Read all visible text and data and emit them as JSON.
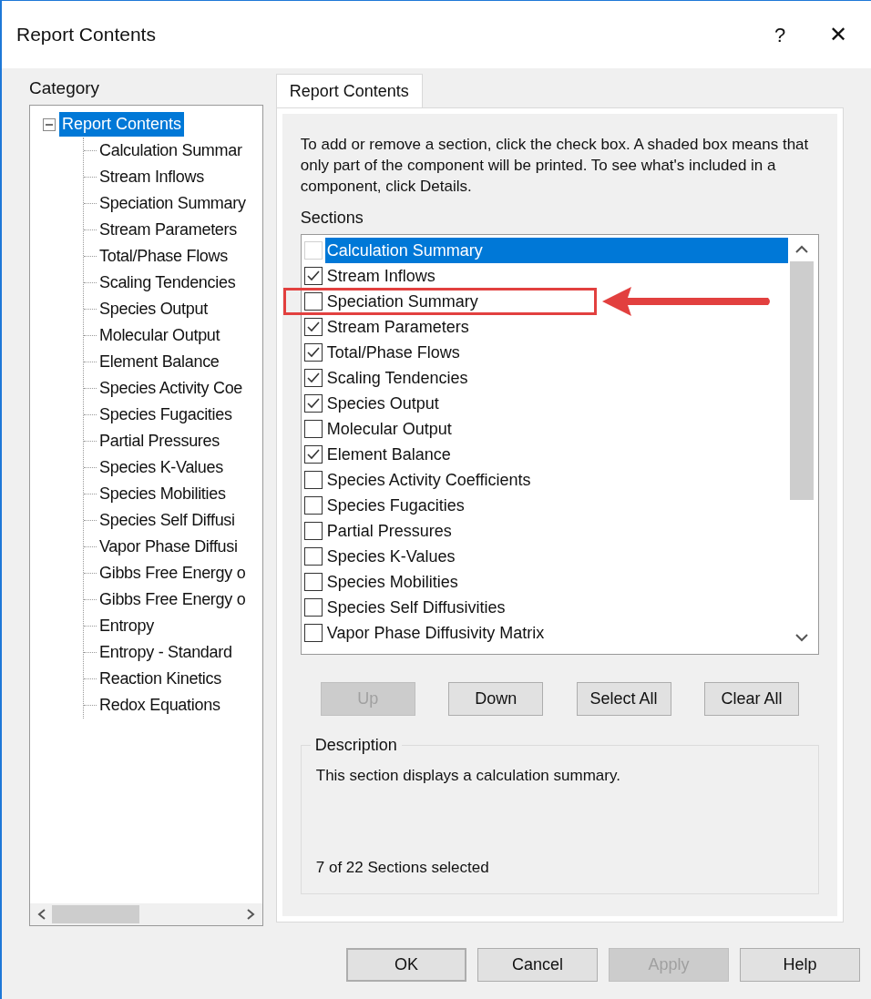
{
  "window": {
    "title": "Report Contents",
    "help_glyph": "?",
    "close_glyph": "✕"
  },
  "category": {
    "label": "Category",
    "tree": [
      {
        "label": "Report Contents",
        "selected": true,
        "expanded": true,
        "children": [
          {
            "label": "Calculation Summar",
            "selected": false
          },
          {
            "label": "Stream Inflows",
            "selected": false
          },
          {
            "label": "Speciation Summary",
            "selected": false
          },
          {
            "label": "Stream Parameters",
            "selected": false
          },
          {
            "label": "Total/Phase Flows",
            "selected": false
          },
          {
            "label": "Scaling Tendencies",
            "selected": false
          },
          {
            "label": "Species Output",
            "selected": false
          },
          {
            "label": "Molecular Output",
            "selected": false
          },
          {
            "label": "Element Balance",
            "selected": false
          },
          {
            "label": "Species Activity Coe",
            "selected": false
          },
          {
            "label": "Species Fugacities",
            "selected": false
          },
          {
            "label": "Partial Pressures",
            "selected": false
          },
          {
            "label": "Species K-Values",
            "selected": false
          },
          {
            "label": "Species Mobilities",
            "selected": false
          },
          {
            "label": "Species Self Diffusi",
            "selected": false
          },
          {
            "label": "Vapor Phase Diffusi",
            "selected": false
          },
          {
            "label": "Gibbs Free Energy o",
            "selected": false
          },
          {
            "label": "Gibbs Free Energy o",
            "selected": false
          },
          {
            "label": "Entropy",
            "selected": false
          },
          {
            "label": "Entropy - Standard",
            "selected": false
          },
          {
            "label": "Reaction Kinetics",
            "selected": false
          },
          {
            "label": "Redox Equations",
            "selected": false
          }
        ]
      }
    ]
  },
  "tabs": [
    {
      "label": "Report Contents",
      "selected": true
    }
  ],
  "instructions": "To add or remove a section, click the check box. A shaded box means that only part of the component will be printed. To see what's included in a component, click Details.",
  "sections": {
    "label": "Sections",
    "items": [
      {
        "label": "Calculation Summary",
        "checked": false,
        "selected": true,
        "highlighted": false
      },
      {
        "label": "Stream Inflows",
        "checked": true,
        "selected": false,
        "highlighted": false
      },
      {
        "label": "Speciation Summary",
        "checked": false,
        "selected": false,
        "highlighted": true
      },
      {
        "label": "Stream Parameters",
        "checked": true,
        "selected": false,
        "highlighted": false
      },
      {
        "label": "Total/Phase Flows",
        "checked": true,
        "selected": false,
        "highlighted": false
      },
      {
        "label": "Scaling Tendencies",
        "checked": true,
        "selected": false,
        "highlighted": false
      },
      {
        "label": "Species Output",
        "checked": true,
        "selected": false,
        "highlighted": false
      },
      {
        "label": "Molecular Output",
        "checked": false,
        "selected": false,
        "highlighted": false
      },
      {
        "label": "Element Balance",
        "checked": true,
        "selected": false,
        "highlighted": false
      },
      {
        "label": "Species Activity Coefficients",
        "checked": false,
        "selected": false,
        "highlighted": false
      },
      {
        "label": "Species Fugacities",
        "checked": false,
        "selected": false,
        "highlighted": false
      },
      {
        "label": "Partial Pressures",
        "checked": false,
        "selected": false,
        "highlighted": false
      },
      {
        "label": "Species K-Values",
        "checked": false,
        "selected": false,
        "highlighted": false
      },
      {
        "label": "Species Mobilities",
        "checked": false,
        "selected": false,
        "highlighted": false
      },
      {
        "label": "Species Self Diffusivities",
        "checked": false,
        "selected": false,
        "highlighted": false
      },
      {
        "label": "Vapor Phase Diffusivity Matrix",
        "checked": false,
        "selected": false,
        "highlighted": false
      }
    ]
  },
  "list_buttons": [
    {
      "label": "Up",
      "disabled": true
    },
    {
      "label": "Down",
      "disabled": false
    },
    {
      "label": "Select All",
      "disabled": false
    },
    {
      "label": "Clear All",
      "disabled": false
    }
  ],
  "description": {
    "label": "Description",
    "text": "This section displays a calculation summary.",
    "count": "7 of 22 Sections selected"
  },
  "dialog_buttons": [
    {
      "label": "OK",
      "disabled": false,
      "default": true
    },
    {
      "label": "Cancel",
      "disabled": false,
      "default": false
    },
    {
      "label": "Apply",
      "disabled": true,
      "default": false
    },
    {
      "label": "Help",
      "disabled": false,
      "default": false
    }
  ]
}
